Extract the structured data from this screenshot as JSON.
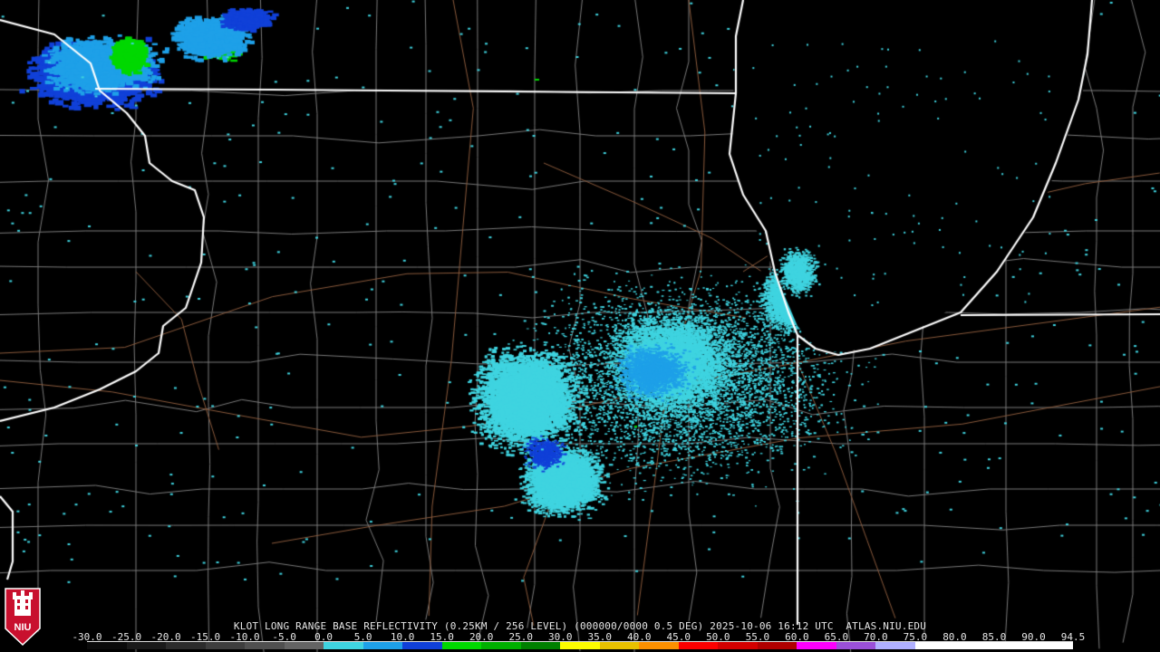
{
  "title": "KLOT LONG RANGE BASE REFLECTIVITY (0.25KM / 256 LEVEL) (000000/0000 0.5 DEG) 2025-10-06 16:12 UTC  ATLAS.NIU.EDU",
  "logo_text": "NIU",
  "colorbar": {
    "labels": [
      "-30.0",
      "-25.0",
      "-20.0",
      "-15.0",
      "-10.0",
      "-5.0",
      "0.0",
      "5.0",
      "10.0",
      "15.0",
      "20.0",
      "25.0",
      "30.0",
      "35.0",
      "40.0",
      "45.0",
      "50.0",
      "55.0",
      "60.0",
      "65.0",
      "70.0",
      "75.0",
      "80.0",
      "85.0",
      "90.0",
      "94.5"
    ],
    "colors": [
      "#0a0a0a",
      "#1a1a1a",
      "#2c2c2c",
      "#3e3e3e",
      "#505050",
      "#646464",
      "#3fd4e0",
      "#1ea0e8",
      "#1040d8",
      "#00d800",
      "#00b000",
      "#008000",
      "#fcfc00",
      "#e8c000",
      "#fc9000",
      "#fc0000",
      "#d40000",
      "#b00000",
      "#fc00fc",
      "#9a50d8",
      "#b0b0ff",
      "#ffffff",
      "#ffffff",
      "#ffffff",
      "#ffffff"
    ]
  },
  "colors": {
    "background": "#000000",
    "state_border": "#ffffff",
    "county_line": "#7a7a7a",
    "road": "#8a5a3c",
    "echo_light": "#3fd4e0",
    "echo_mid": "#1ea0e8",
    "echo_dark": "#1040d8",
    "echo_green": "#00d800"
  }
}
